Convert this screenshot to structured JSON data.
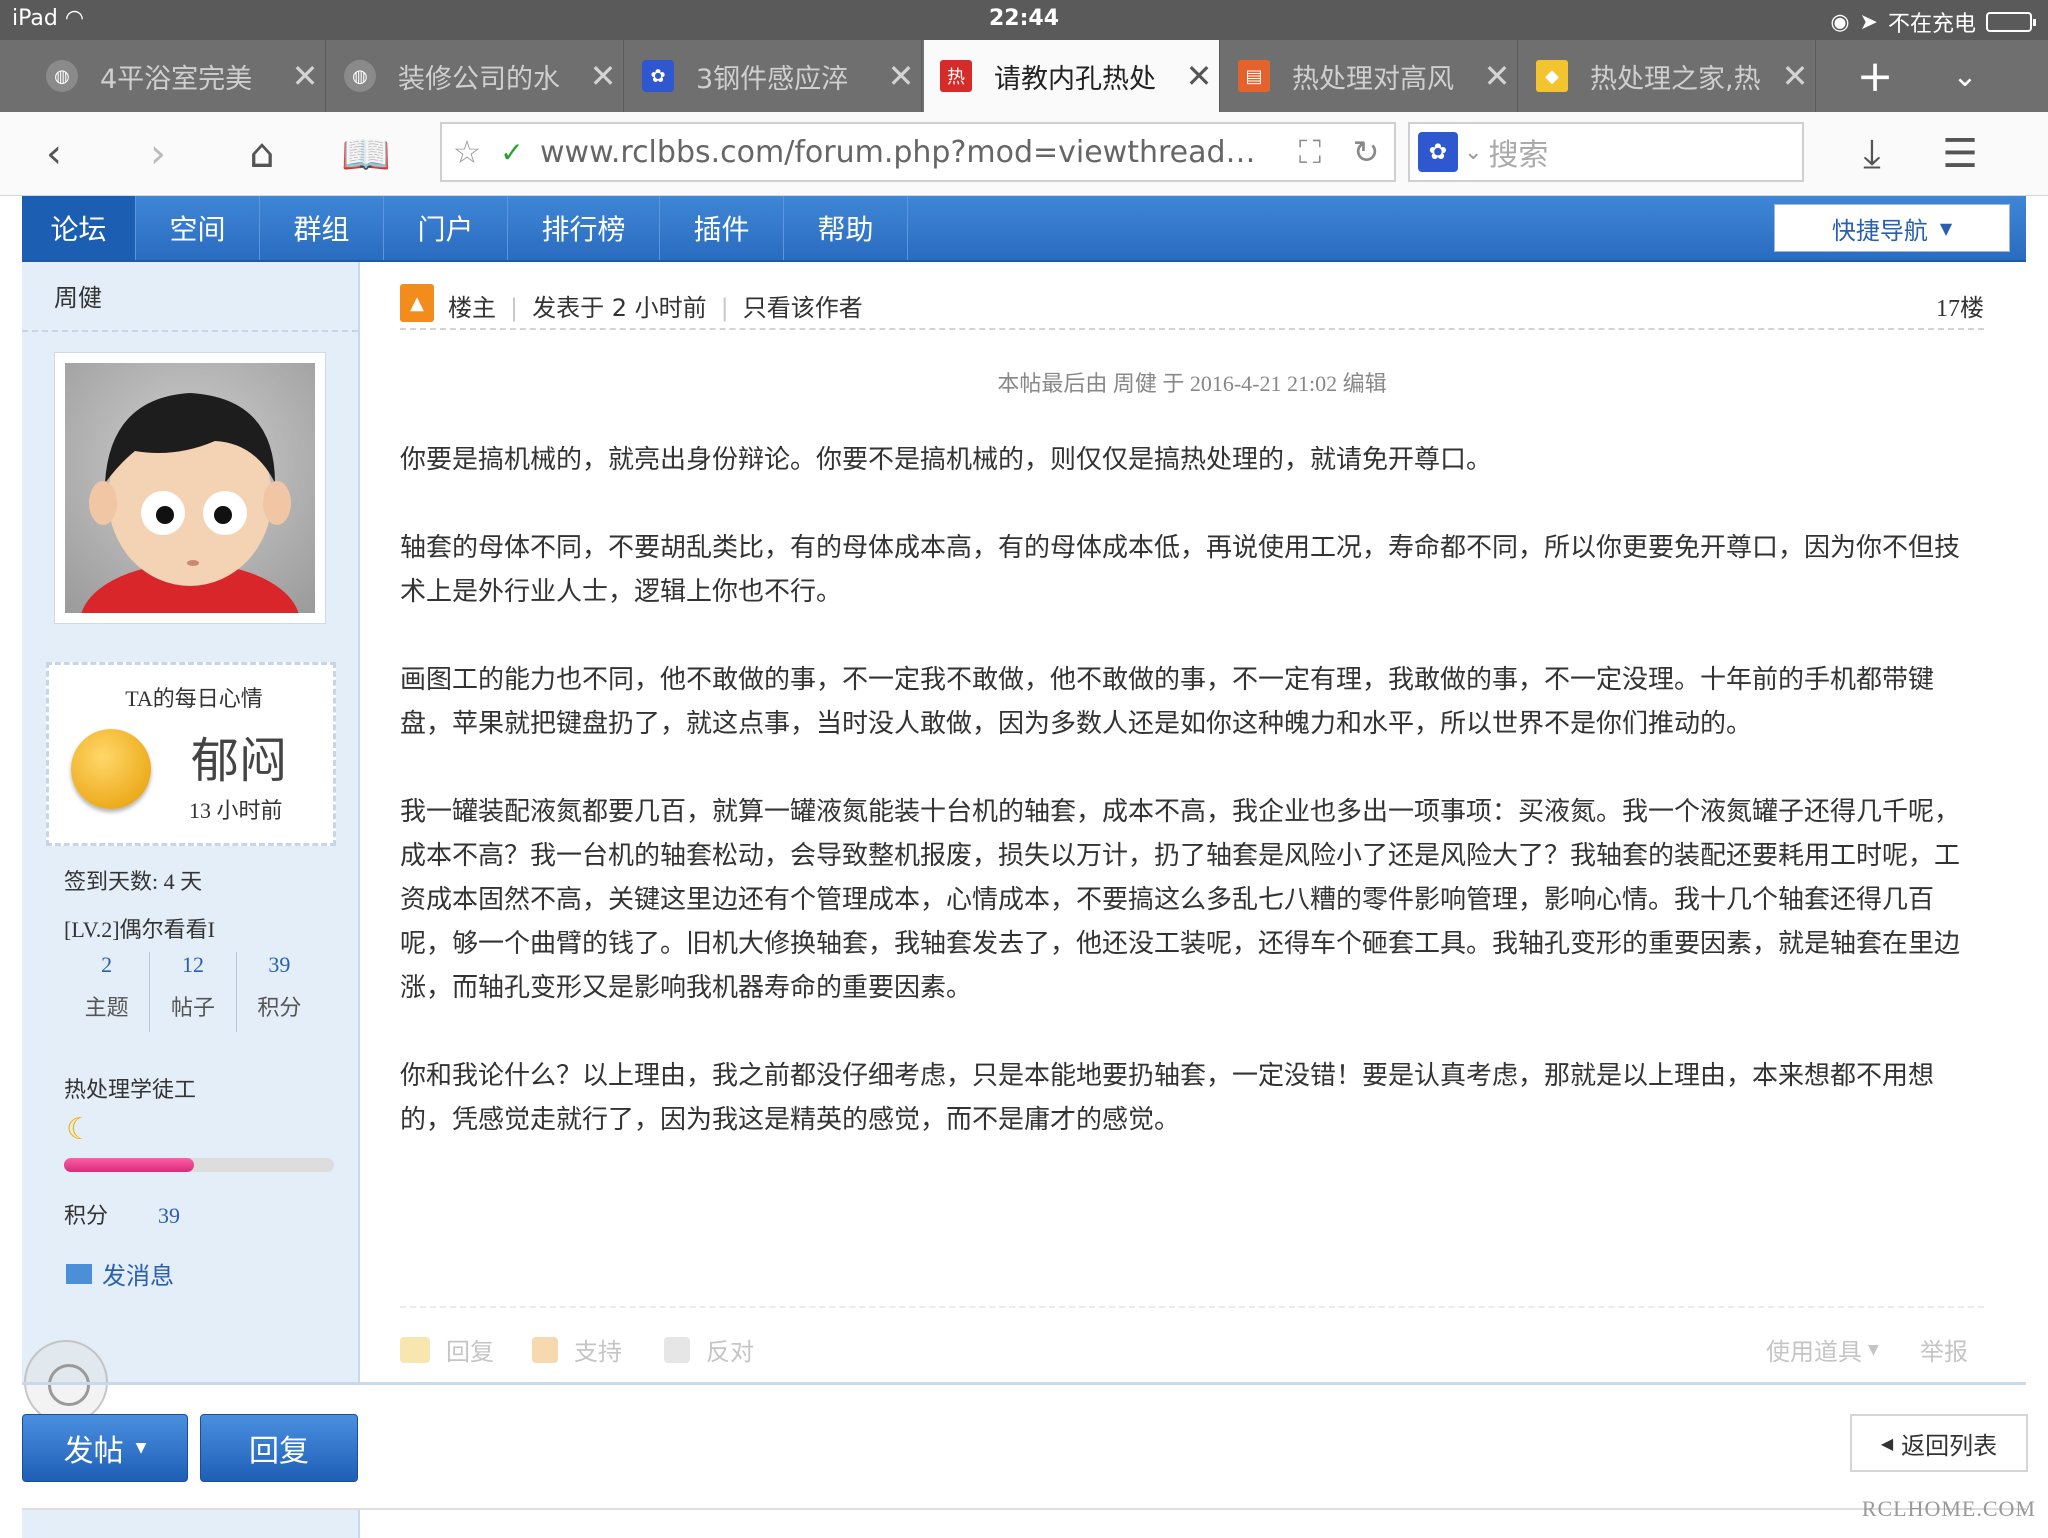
{
  "status": {
    "device": "iPad",
    "time": "22:44",
    "charge": "不在充电"
  },
  "tabs": [
    {
      "label": "4平浴室完美"
    },
    {
      "label": "装修公司的水"
    },
    {
      "label": "3钢件感应淬"
    },
    {
      "label": "请教内孔热处"
    },
    {
      "label": "热处理对高风"
    },
    {
      "label": "热处理之家,热"
    }
  ],
  "address": {
    "url": "www.rclbbs.com/forum.php?mod=viewthread…",
    "search_placeholder": "搜索"
  },
  "nav": {
    "items": [
      "论坛",
      "空间",
      "群组",
      "门户",
      "排行榜",
      "插件",
      "帮助"
    ],
    "quick": "快捷导航"
  },
  "profile": {
    "name": "周健",
    "mood_title": "TA的每日心情",
    "mood": "郁闷",
    "mood_time": "13 小时前",
    "signin": "签到天数: 4 天",
    "level": "[LV.2]偶尔看看I",
    "stats": [
      {
        "value": "2",
        "label": "主题"
      },
      {
        "value": "12",
        "label": "帖子"
      },
      {
        "value": "39",
        "label": "积分"
      }
    ],
    "rank": "热处理学徒工",
    "points_label": "积分",
    "points_value": "39",
    "progress_fraction": 0.48,
    "message": "发消息"
  },
  "post": {
    "badge": "楼主",
    "posted": "发表于 2 小时前",
    "only_author": "只看该作者",
    "floor": "17楼",
    "edit_note": "本帖最后由 周健 于 2016-4-21 21:02 编辑",
    "paragraphs": [
      "你要是搞机械的，就亮出身份辩论。你要不是搞机械的，则仅仅是搞热处理的，就请免开尊口。",
      "轴套的母体不同，不要胡乱类比，有的母体成本高，有的母体成本低，再说使用工况，寿命都不同，所以你更要免开尊口，因为你不但技术上是外行业人士，逻辑上你也不行。",
      "画图工的能力也不同，他不敢做的事，不一定我不敢做，他不敢做的事，不一定有理，我敢做的事，不一定没理。十年前的手机都带键盘，苹果就把键盘扔了，就这点事，当时没人敢做，因为多数人还是如你这种魄力和水平，所以世界不是你们推动的。",
      "我一罐装配液氮都要几百，就算一罐液氮能装十台机的轴套，成本不高，我企业也多出一项事项：买液氮。我一个液氮罐子还得几千呢，成本不高？我一台机的轴套松动，会导致整机报废，损失以万计，扔了轴套是风险小了还是风险大了？我轴套的装配还要耗用工时呢，工资成本固然不高，关键这里边还有个管理成本，心情成本，不要搞这么多乱七八糟的零件影响管理，影响心情。我十几个轴套还得几百呢，够一个曲臂的钱了。旧机大修换轴套，我轴套发去了，他还没工装呢，还得车个砸套工具。我轴孔变形的重要因素，就是轴套在里边涨，而轴孔变形又是影响我机器寿命的重要因素。",
      "你和我论什么？以上理由，我之前都没仔细考虑，只是本能地要扔轴套，一定没错！要是认真考虑，那就是以上理由，本来想都不用想的，凭感觉走就行了，因为我这是精英的感觉，而不是庸才的感觉。"
    ],
    "actions": {
      "reply": "回复",
      "support": "支持",
      "oppose": "反对",
      "tools": "使用道具",
      "report": "举报"
    }
  },
  "footer": {
    "new_post": "发帖",
    "reply": "回复",
    "back": "返回列表",
    "watermark": "RCLHOME.COM"
  },
  "colors": {
    "nav_blue": "#2a6cc0",
    "link_blue": "#2a5fb0",
    "sidebar_bg": "#e4eef8"
  }
}
